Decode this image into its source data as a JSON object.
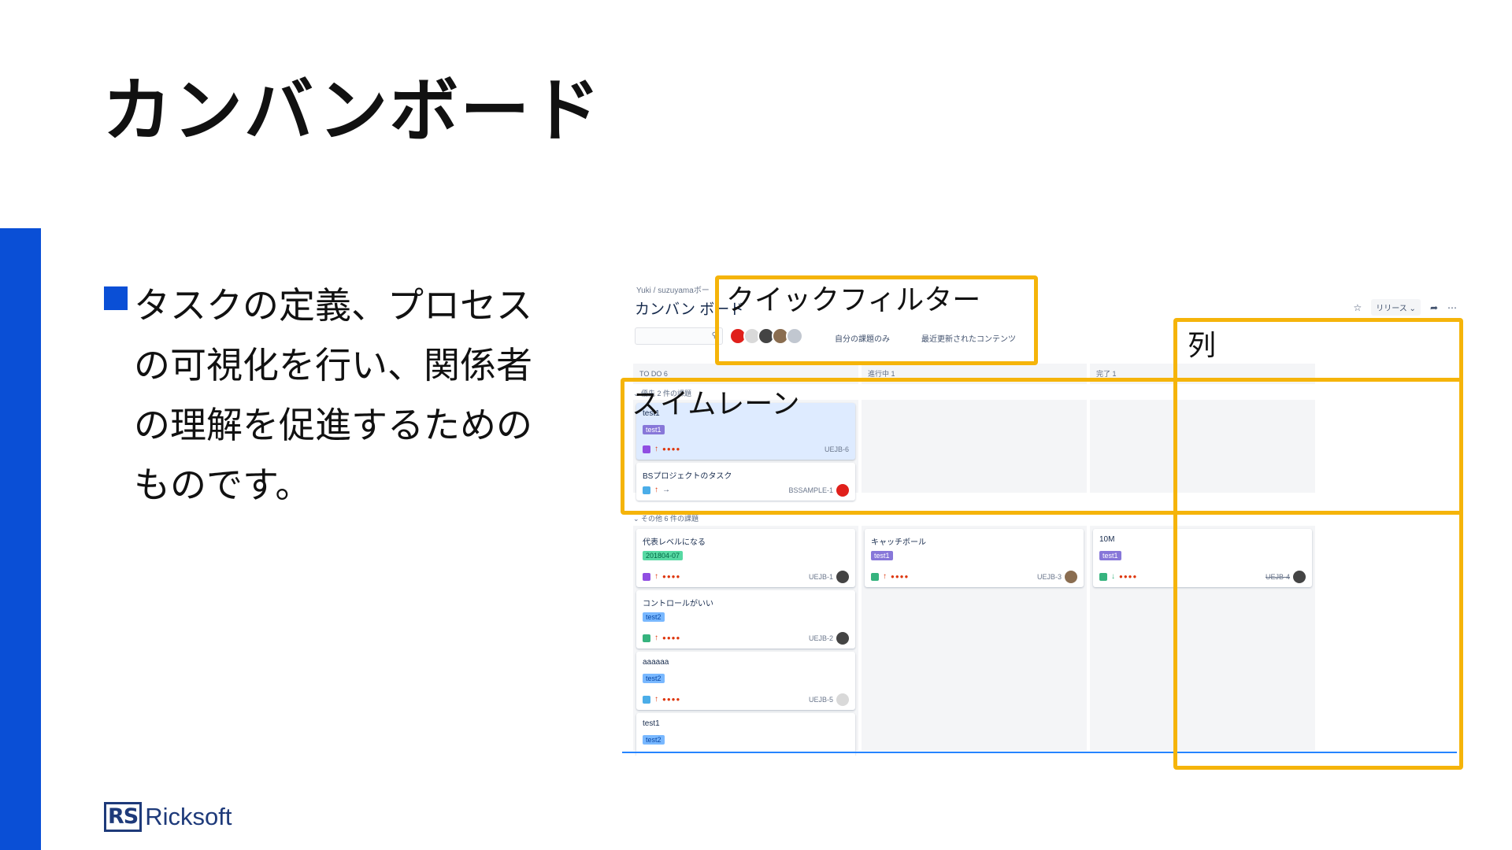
{
  "slide": {
    "title": "カンバンボード",
    "bullet": "タスクの定義、プロセスの可視化を行い、関係者の理解を促進するためのものです。",
    "accent_color": "#0a4fd6",
    "highlight_color": "#f5b40a"
  },
  "logo": {
    "mark": "RS",
    "brand": "Ricksoft"
  },
  "board": {
    "breadcrumb": "Yuki  /  suzuyamaボー",
    "title": "カンバン ボード",
    "search_icon": "search-icon",
    "filters": [
      "自分の課題のみ",
      "最近更新されたコンテンツ"
    ],
    "release_label": "リリース ⌄",
    "columns": [
      {
        "name": "TO DO 6"
      },
      {
        "name": "進行中 1"
      },
      {
        "name": "完了 1"
      }
    ],
    "swimlanes": [
      {
        "name": "⌄ 優先 2 件の課題"
      },
      {
        "name": "⌄ その他 6 件の課題"
      }
    ],
    "cards": {
      "c1": {
        "title": "test1",
        "label": "test1",
        "key": "UEJB-6"
      },
      "c2": {
        "title": "BSプロジェクトのタスク",
        "key": "BSSAMPLE-1"
      },
      "c3": {
        "title": "代表レベルになる",
        "label": "201804-07",
        "key": "UEJB-1"
      },
      "c4": {
        "title": "コントロールがいい",
        "label": "test2",
        "key": "UEJB-2"
      },
      "c5": {
        "title": "aaaaaa",
        "label": "test2",
        "key": "UEJB-5"
      },
      "c6": {
        "title": "test1",
        "label": "test2"
      },
      "c7": {
        "title": "キャッチボール",
        "label": "test1",
        "key": "UEJB-3"
      },
      "c8": {
        "title": "10M",
        "label": "test1",
        "key": "UEJB-4"
      }
    }
  },
  "annotations": {
    "quick_filter": "クイックフィルター",
    "column": "列",
    "swimlane": "スイムレーン"
  }
}
